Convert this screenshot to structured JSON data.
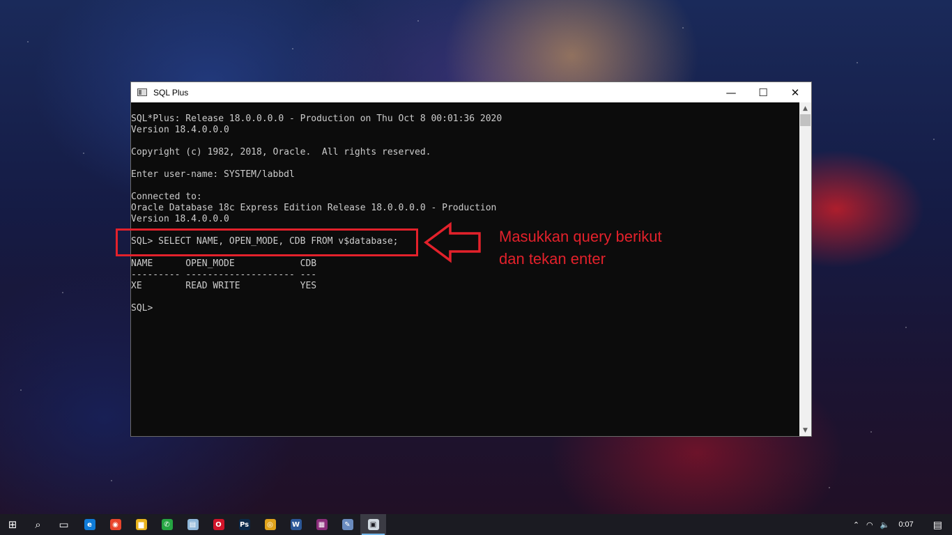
{
  "window": {
    "title": "SQL Plus",
    "controls": {
      "minimize": "—",
      "maximize": "☐",
      "close": "✕"
    }
  },
  "console": {
    "lines": [
      "SQL*Plus: Release 18.0.0.0.0 - Production on Thu Oct 8 00:01:36 2020",
      "Version 18.4.0.0.0",
      "",
      "Copyright (c) 1982, 2018, Oracle.  All rights reserved.",
      "",
      "Enter user-name: SYSTEM/labbdl",
      "",
      "Connected to:",
      "Oracle Database 18c Express Edition Release 18.0.0.0.0 - Production",
      "Version 18.4.0.0.0",
      "",
      "SQL> SELECT NAME, OPEN_MODE, CDB FROM v$database;",
      "",
      "NAME      OPEN_MODE            CDB",
      "--------- -------------------- ---",
      "XE        READ WRITE           YES",
      "",
      "SQL>"
    ]
  },
  "annotation": {
    "line1": "Masukkan query berikut",
    "line2": "dan tekan enter",
    "color": "#e3212b"
  },
  "taskbar": {
    "items": [
      {
        "icon": "windows-start-icon",
        "glyph": "⊞"
      },
      {
        "icon": "search-icon",
        "glyph": "⌕"
      },
      {
        "icon": "task-view-icon",
        "glyph": "▭"
      },
      {
        "icon": "edge-icon",
        "glyph": "e"
      },
      {
        "icon": "snipping-icon",
        "glyph": "◉"
      },
      {
        "icon": "file-explorer-icon",
        "glyph": "▆"
      },
      {
        "icon": "whatsapp-icon",
        "glyph": "✆"
      },
      {
        "icon": "notepad-icon",
        "glyph": "▤"
      },
      {
        "icon": "opera-icon",
        "glyph": "O"
      },
      {
        "icon": "photoshop-icon",
        "glyph": "Ps"
      },
      {
        "icon": "chrome-icon",
        "glyph": "◎"
      },
      {
        "icon": "word-icon",
        "glyph": "W"
      },
      {
        "icon": "winrar-icon",
        "glyph": "▦"
      },
      {
        "icon": "paint-icon",
        "glyph": "✎"
      },
      {
        "icon": "sqlplus-icon",
        "glyph": "▣"
      }
    ],
    "tray": {
      "chevron": "⌃",
      "wifi": "◠",
      "volume": "🔈",
      "time": "0:07",
      "notifications": "▤"
    }
  }
}
